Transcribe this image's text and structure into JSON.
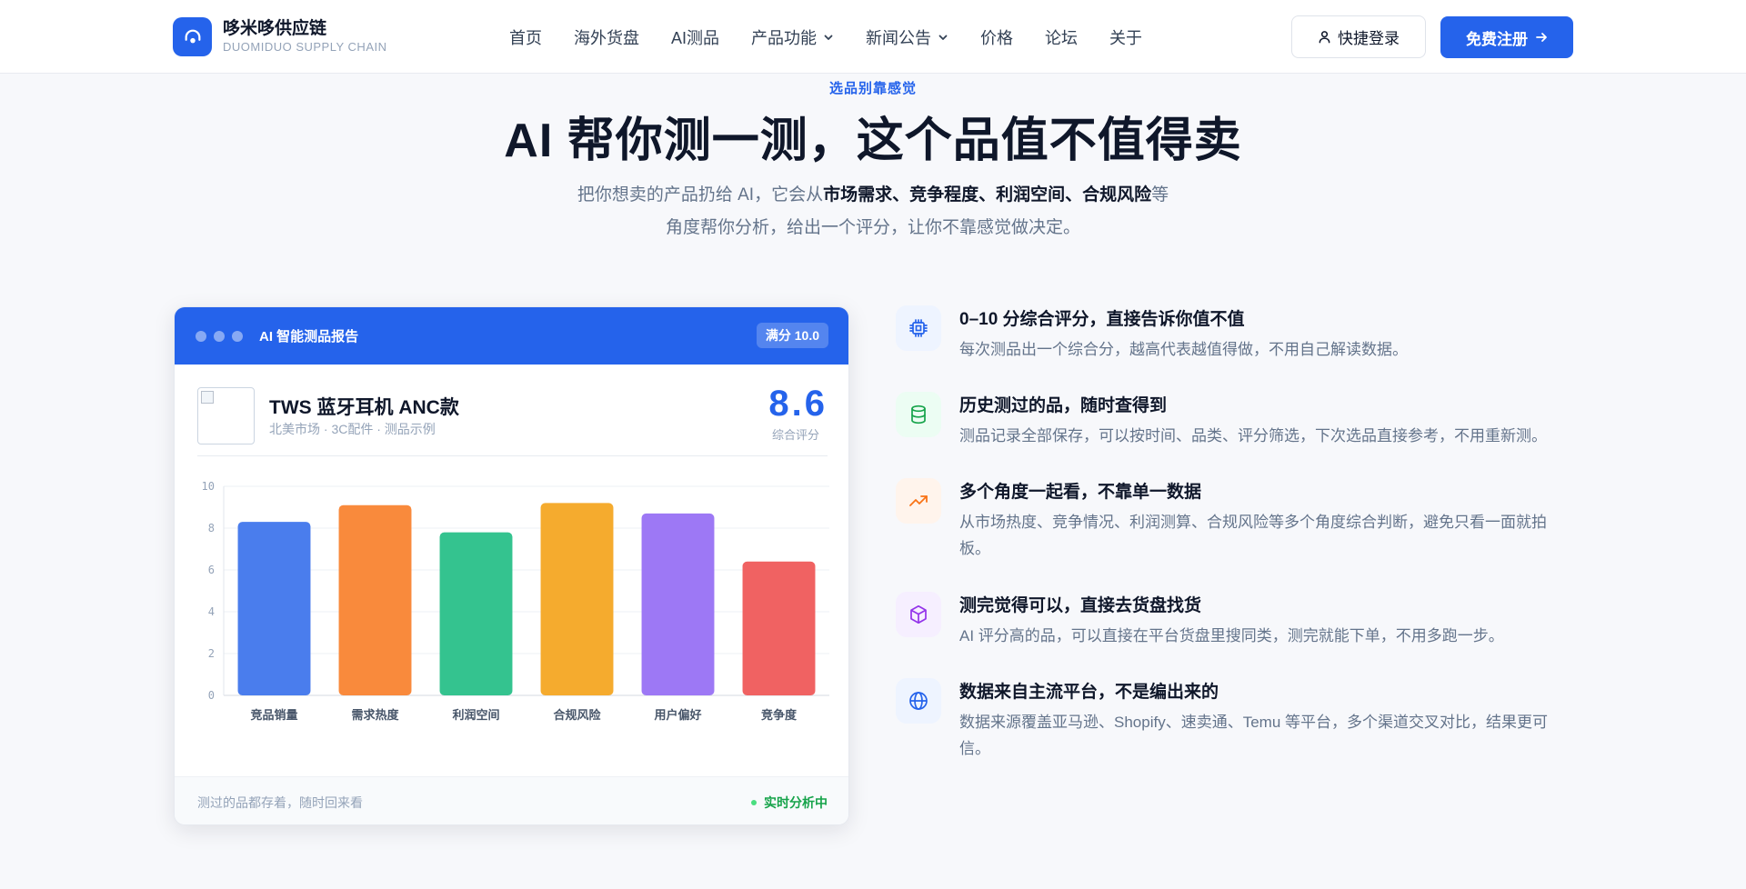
{
  "brand": {
    "name": "哆米哆供应链",
    "subtitle": "DUOMIDUO SUPPLY CHAIN"
  },
  "nav": {
    "items": [
      {
        "label": "首页",
        "dropdown": false
      },
      {
        "label": "海外货盘",
        "dropdown": false
      },
      {
        "label": "AI测品",
        "dropdown": false
      },
      {
        "label": "产品功能",
        "dropdown": true
      },
      {
        "label": "新闻公告",
        "dropdown": true
      },
      {
        "label": "价格",
        "dropdown": false
      },
      {
        "label": "论坛",
        "dropdown": false
      },
      {
        "label": "关于",
        "dropdown": false
      }
    ],
    "login_label": "快捷登录",
    "signup_label": "免费注册"
  },
  "hero": {
    "eyebrow": "选品别靠感觉",
    "title": "AI 帮你测一测，这个品值不值得卖",
    "subtitle_prefix": "把你想卖的产品扔给 AI，它会从",
    "subtitle_bold": "市场需求、竞争程度、利润空间、合规风险",
    "subtitle_suffix": "等",
    "subtitle_line2": "角度帮你分析，给出一个评分，让你不靠感觉做决定。"
  },
  "report": {
    "title": "AI 智能测品报告",
    "max_score_badge": "满分 10.0",
    "product_name": "TWS 蓝牙耳机 ANC款",
    "product_meta": "北美市场 · 3C配件 · 测品示例",
    "score": "8.6",
    "score_label": "综合评分",
    "footer_left": "测过的品都存着，随时回来看",
    "footer_right": "实时分析中"
  },
  "chart_data": {
    "type": "bar",
    "categories": [
      "竞品销量",
      "需求热度",
      "利润空间",
      "合规风险",
      "用户偏好",
      "竞争度"
    ],
    "values": [
      8.3,
      9.1,
      7.8,
      9.2,
      8.7,
      6.4
    ],
    "colors": [
      "#4a7ded",
      "#f98a3c",
      "#34c38f",
      "#f5ab2e",
      "#9d78f5",
      "#f06262"
    ],
    "ylim": [
      0,
      10
    ],
    "yticks": [
      "0",
      "2",
      "4",
      "6",
      "8",
      "10"
    ],
    "grid": true
  },
  "features": [
    {
      "icon": "chip-icon",
      "color": "#2563eb",
      "bg": "#eef4ff",
      "title": "0–10 分综合评分，直接告诉你值不值",
      "desc": "每次测品出一个综合分，越高代表越值得做，不用自己解读数据。"
    },
    {
      "icon": "database-icon",
      "color": "#16a34a",
      "bg": "#ecfdf3",
      "title": "历史测过的品，随时查得到",
      "desc": "测品记录全部保存，可以按时间、品类、评分筛选，下次选品直接参考，不用重新测。"
    },
    {
      "icon": "trend-up-icon",
      "color": "#f97316",
      "bg": "#fff4ec",
      "title": "多个角度一起看，不靠单一数据",
      "desc": "从市场热度、竞争情况、利润测算、合规风险等多个角度综合判断，避免只看一面就拍板。"
    },
    {
      "icon": "box-icon",
      "color": "#9333ea",
      "bg": "#f6efff",
      "title": "测完觉得可以，直接去货盘找货",
      "desc": "AI 评分高的品，可以直接在平台货盘里搜同类，测完就能下单，不用多跑一步。"
    },
    {
      "icon": "globe-icon",
      "color": "#2563eb",
      "bg": "#eef4ff",
      "title": "数据来自主流平台，不是编出来的",
      "desc": "数据来源覆盖亚马逊、Shopify、速卖通、Temu 等平台，多个渠道交叉对比，结果更可信。"
    }
  ]
}
